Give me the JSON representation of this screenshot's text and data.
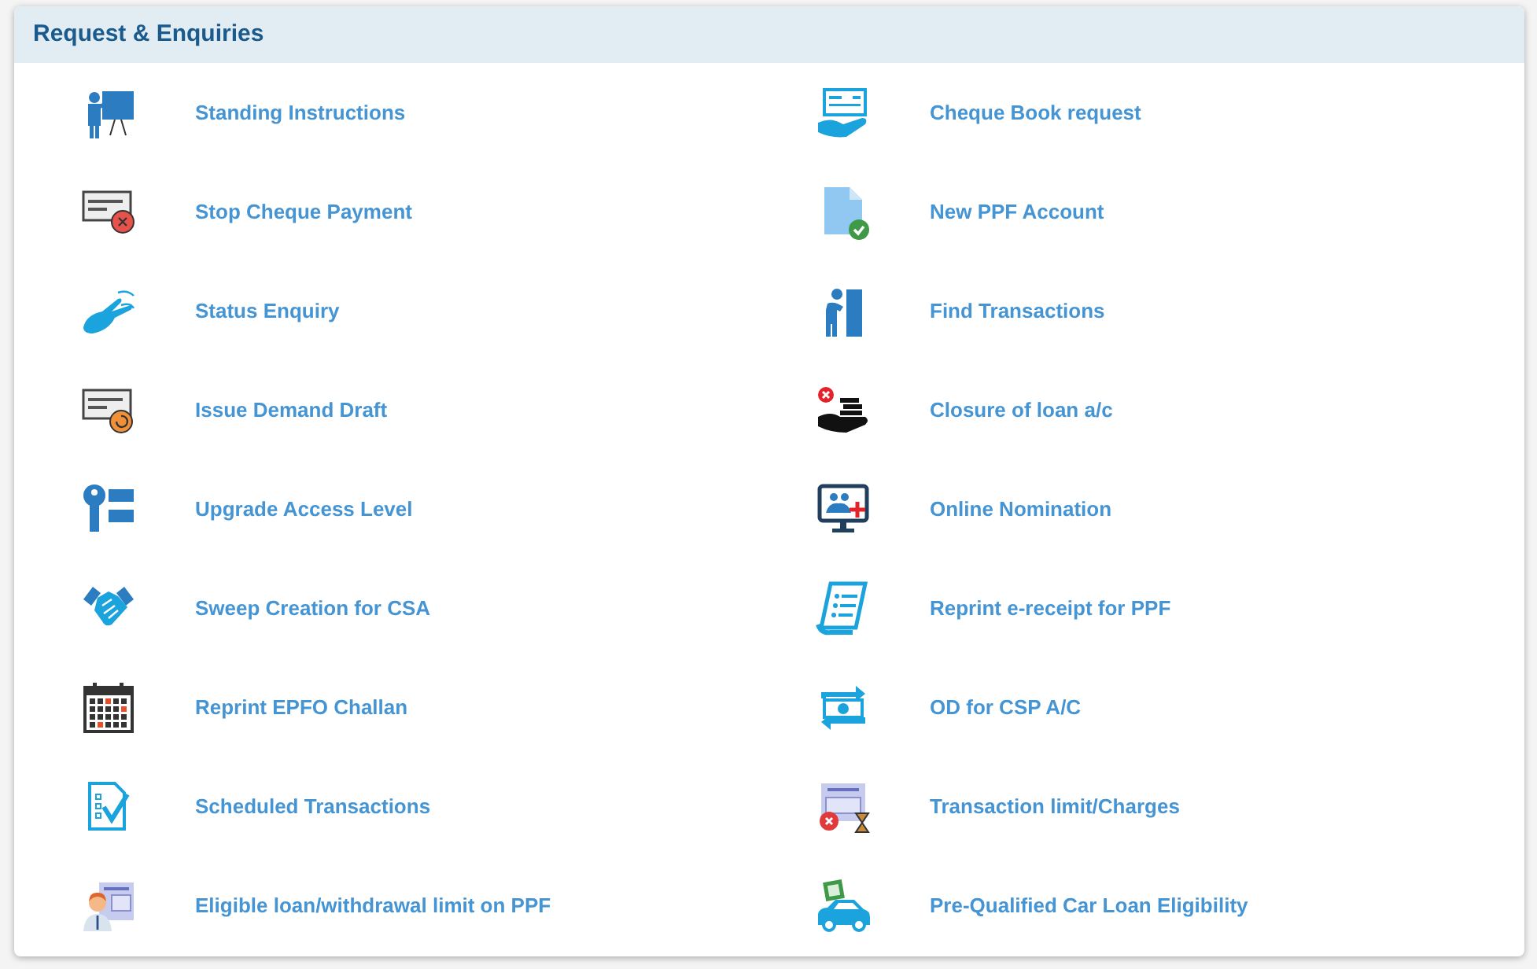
{
  "panel": {
    "title": "Request & Enquiries",
    "items": [
      {
        "label": "Standing Instructions"
      },
      {
        "label": "Cheque Book request"
      },
      {
        "label": "Stop Cheque Payment"
      },
      {
        "label": "New PPF Account"
      },
      {
        "label": "Status Enquiry"
      },
      {
        "label": "Find Transactions"
      },
      {
        "label": "Issue Demand Draft"
      },
      {
        "label": "Closure of loan a/c"
      },
      {
        "label": "Upgrade Access Level"
      },
      {
        "label": "Online Nomination"
      },
      {
        "label": "Sweep Creation for CSA"
      },
      {
        "label": "Reprint e-receipt for PPF"
      },
      {
        "label": "Reprint EPFO Challan"
      },
      {
        "label": "OD for CSP A/C"
      },
      {
        "label": "Scheduled Transactions"
      },
      {
        "label": "Transaction limit/Charges"
      },
      {
        "label": "Eligible loan/withdrawal limit on PPF"
      },
      {
        "label": "Pre-Qualified Car Loan Eligibility"
      }
    ]
  }
}
